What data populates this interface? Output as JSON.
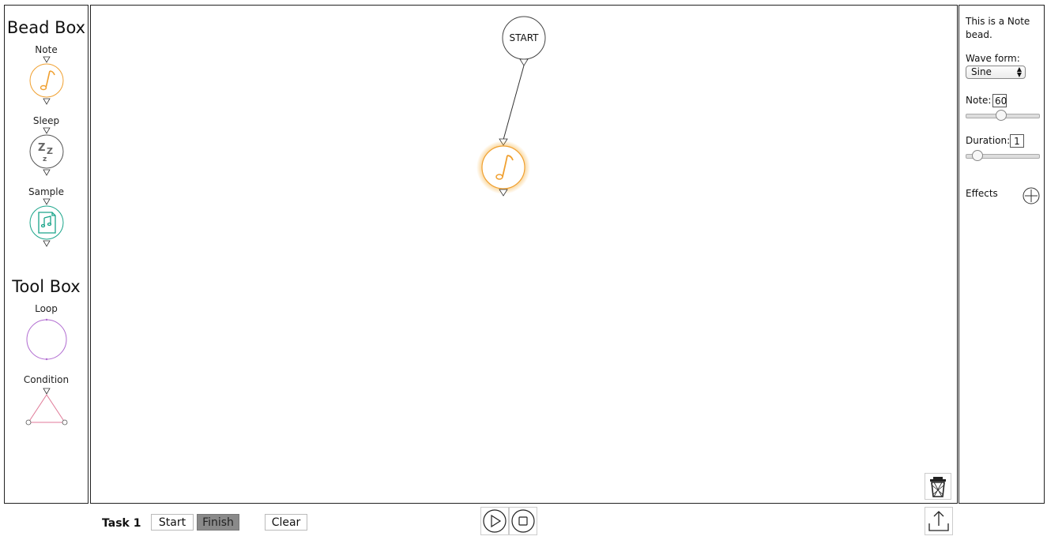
{
  "bead_box": {
    "title": "Bead Box",
    "items": [
      {
        "label": "Note"
      },
      {
        "label": "Sleep"
      },
      {
        "label": "Sample"
      }
    ]
  },
  "tool_box": {
    "title": "Tool Box",
    "items": [
      {
        "label": "Loop"
      },
      {
        "label": "Condition"
      }
    ]
  },
  "canvas": {
    "start_label": "START"
  },
  "properties": {
    "description": "This is a Note bead.",
    "wave_form_label": "Wave form:",
    "wave_form_value": "Sine",
    "note_label": "Note:",
    "note_value": "60",
    "duration_label": "Duration:",
    "duration_value": "1",
    "effects_label": "Effects"
  },
  "bottom_bar": {
    "task_label": "Task 1",
    "start_label": "Start",
    "finish_label": "Finish",
    "clear_label": "Clear"
  },
  "colors": {
    "note": "#f0a030",
    "sleep": "#555555",
    "sample": "#1aa58a",
    "loop": "#b06ad0",
    "condition": "#e07a98",
    "finish_bg": "#8a8a8a"
  }
}
